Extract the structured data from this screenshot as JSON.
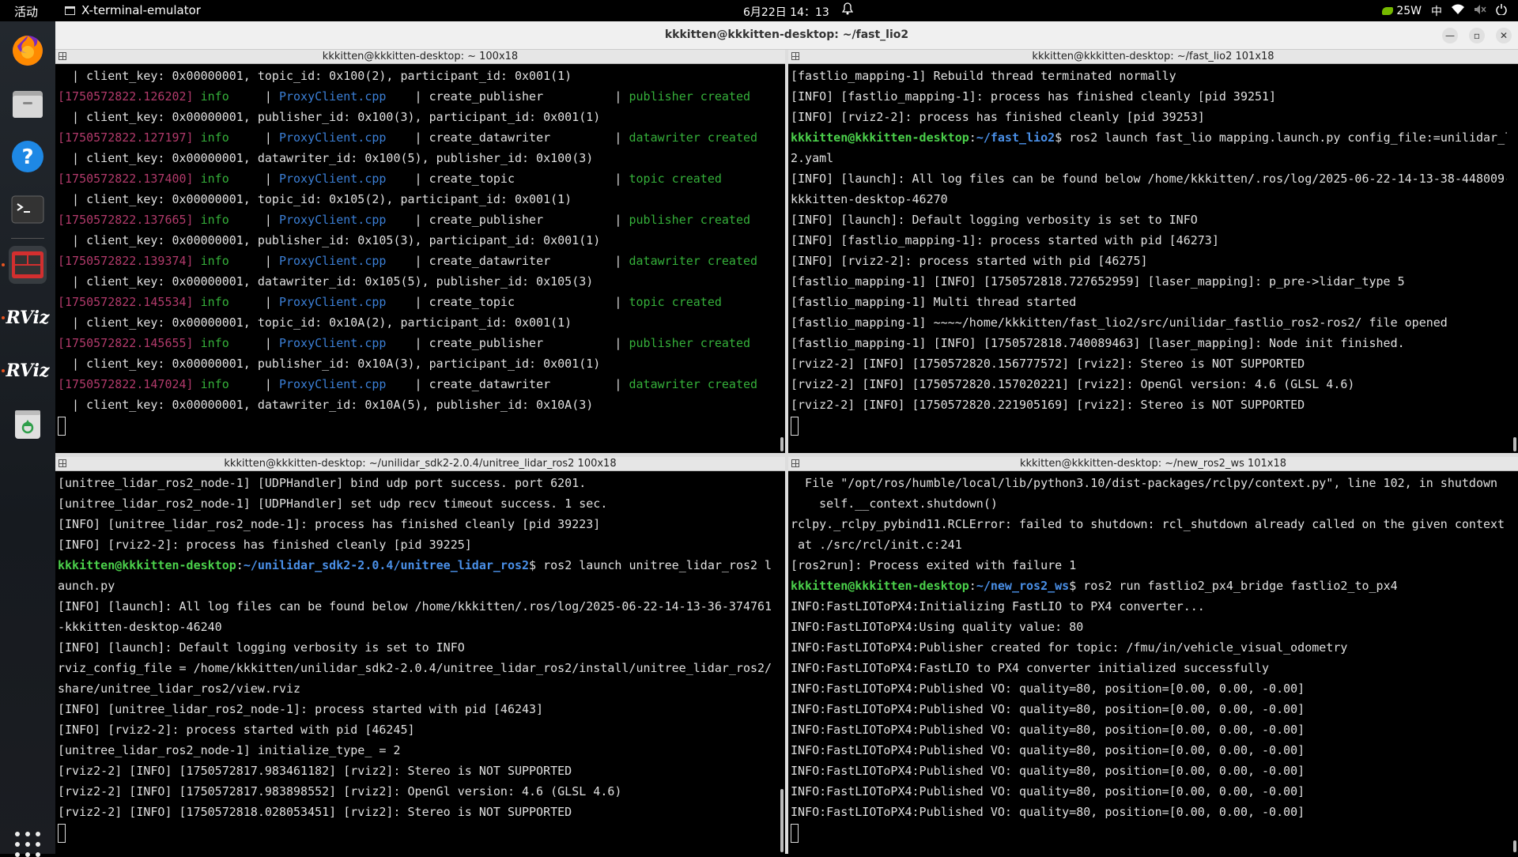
{
  "topbar": {
    "activities": "活动",
    "app_name": "X-terminal-emulator",
    "datetime": "6月22日  14：13",
    "power": "25W",
    "input_method": "中"
  },
  "dock": {
    "icons": [
      "firefox-icon",
      "files-icon",
      "help-icon",
      "terminal-icon",
      "terminator-icon",
      "rviz-icon",
      "rviz-icon",
      "trash-icon"
    ],
    "rviz_label": "RViz"
  },
  "window": {
    "title": "kkkitten@kkkitten-desktop: ~/fast_lio2"
  },
  "panes": {
    "top_left": {
      "title": "kkkitten@kkkitten-desktop: ~ 100x18",
      "lines": [
        [
          {
            "t": "  | client_key: 0x00000001, topic_id: 0x100(2), participant_id: 0x001(1)"
          }
        ],
        [
          {
            "t": "[1750572822.126202]",
            "c": "ts"
          },
          {
            "t": " "
          },
          {
            "t": "info",
            "c": "info"
          },
          {
            "t": "     | "
          },
          {
            "t": "ProxyClient.cpp",
            "c": "file"
          },
          {
            "t": "    | "
          },
          {
            "t": "create_publisher",
            "c": ""
          },
          {
            "t": "          | "
          },
          {
            "t": "publisher created",
            "c": "msg"
          }
        ],
        [
          {
            "t": "  | client_key: 0x00000001, publisher_id: 0x100(3), participant_id: 0x001(1)"
          }
        ],
        [
          {
            "t": "[1750572822.127197]",
            "c": "ts"
          },
          {
            "t": " "
          },
          {
            "t": "info",
            "c": "info"
          },
          {
            "t": "     | "
          },
          {
            "t": "ProxyClient.cpp",
            "c": "file"
          },
          {
            "t": "    | "
          },
          {
            "t": "create_datawriter",
            "c": ""
          },
          {
            "t": "         | "
          },
          {
            "t": "datawriter created",
            "c": "msg"
          }
        ],
        [
          {
            "t": "  | client_key: 0x00000001, datawriter_id: 0x100(5), publisher_id: 0x100(3)"
          }
        ],
        [
          {
            "t": "[1750572822.137400]",
            "c": "ts"
          },
          {
            "t": " "
          },
          {
            "t": "info",
            "c": "info"
          },
          {
            "t": "     | "
          },
          {
            "t": "ProxyClient.cpp",
            "c": "file"
          },
          {
            "t": "    | "
          },
          {
            "t": "create_topic",
            "c": ""
          },
          {
            "t": "              | "
          },
          {
            "t": "topic created",
            "c": "msg"
          }
        ],
        [
          {
            "t": "  | client_key: 0x00000001, topic_id: 0x105(2), participant_id: 0x001(1)"
          }
        ],
        [
          {
            "t": "[1750572822.137665]",
            "c": "ts"
          },
          {
            "t": " "
          },
          {
            "t": "info",
            "c": "info"
          },
          {
            "t": "     | "
          },
          {
            "t": "ProxyClient.cpp",
            "c": "file"
          },
          {
            "t": "    | "
          },
          {
            "t": "create_publisher",
            "c": ""
          },
          {
            "t": "          | "
          },
          {
            "t": "publisher created",
            "c": "msg"
          }
        ],
        [
          {
            "t": "  | client_key: 0x00000001, publisher_id: 0x105(3), participant_id: 0x001(1)"
          }
        ],
        [
          {
            "t": "[1750572822.139374]",
            "c": "ts"
          },
          {
            "t": " "
          },
          {
            "t": "info",
            "c": "info"
          },
          {
            "t": "     | "
          },
          {
            "t": "ProxyClient.cpp",
            "c": "file"
          },
          {
            "t": "    | "
          },
          {
            "t": "create_datawriter",
            "c": ""
          },
          {
            "t": "         | "
          },
          {
            "t": "datawriter created",
            "c": "msg"
          }
        ],
        [
          {
            "t": "  | client_key: 0x00000001, datawriter_id: 0x105(5), publisher_id: 0x105(3)"
          }
        ],
        [
          {
            "t": "[1750572822.145534]",
            "c": "ts"
          },
          {
            "t": " "
          },
          {
            "t": "info",
            "c": "info"
          },
          {
            "t": "     | "
          },
          {
            "t": "ProxyClient.cpp",
            "c": "file"
          },
          {
            "t": "    | "
          },
          {
            "t": "create_topic",
            "c": ""
          },
          {
            "t": "              | "
          },
          {
            "t": "topic created",
            "c": "msg"
          }
        ],
        [
          {
            "t": "  | client_key: 0x00000001, topic_id: 0x10A(2), participant_id: 0x001(1)"
          }
        ],
        [
          {
            "t": "[1750572822.145655]",
            "c": "ts"
          },
          {
            "t": " "
          },
          {
            "t": "info",
            "c": "info"
          },
          {
            "t": "     | "
          },
          {
            "t": "ProxyClient.cpp",
            "c": "file"
          },
          {
            "t": "    | "
          },
          {
            "t": "create_publisher",
            "c": ""
          },
          {
            "t": "          | "
          },
          {
            "t": "publisher created",
            "c": "msg"
          }
        ],
        [
          {
            "t": "  | client_key: 0x00000001, publisher_id: 0x10A(3), participant_id: 0x001(1)"
          }
        ],
        [
          {
            "t": "[1750572822.147024]",
            "c": "ts"
          },
          {
            "t": " "
          },
          {
            "t": "info",
            "c": "info"
          },
          {
            "t": "     | "
          },
          {
            "t": "ProxyClient.cpp",
            "c": "file"
          },
          {
            "t": "    | "
          },
          {
            "t": "create_datawriter",
            "c": ""
          },
          {
            "t": "         | "
          },
          {
            "t": "datawriter created",
            "c": "msg"
          }
        ],
        [
          {
            "t": "  | client_key: 0x00000001, datawriter_id: 0x10A(5), publisher_id: 0x10A(3)"
          }
        ]
      ]
    },
    "top_right": {
      "title": "kkkitten@kkkitten-desktop: ~/fast_lio2 101x18",
      "lines": [
        [
          {
            "t": "[fastlio_mapping-1] Rebuild thread terminated normally"
          }
        ],
        [
          {
            "t": "[INFO] [fastlio_mapping-1]: process has finished cleanly [pid 39251]"
          }
        ],
        [
          {
            "t": "[INFO] [rviz2-2]: process has finished cleanly [pid 39253]"
          }
        ],
        [
          {
            "t": "kkkitten@kkkitten-desktop",
            "c": "user"
          },
          {
            "t": ":"
          },
          {
            "t": "~/fast_lio2",
            "c": "path"
          },
          {
            "t": "$ ros2 launch fast_lio mapping.launch.py config_file:=unilidar_l"
          }
        ],
        [
          {
            "t": "2.yaml"
          }
        ],
        [
          {
            "t": "[INFO] [launch]: All log files can be found below /home/kkkitten/.ros/log/2025-06-22-14-13-38-448009-"
          }
        ],
        [
          {
            "t": "kkkitten-desktop-46270"
          }
        ],
        [
          {
            "t": "[INFO] [launch]: Default logging verbosity is set to INFO"
          }
        ],
        [
          {
            "t": "[INFO] [fastlio_mapping-1]: process started with pid [46273]"
          }
        ],
        [
          {
            "t": "[INFO] [rviz2-2]: process started with pid [46275]"
          }
        ],
        [
          {
            "t": "[fastlio_mapping-1] [INFO] [1750572818.727652959] [laser_mapping]: p_pre->lidar_type 5"
          }
        ],
        [
          {
            "t": "[fastlio_mapping-1] Multi thread started"
          }
        ],
        [
          {
            "t": "[fastlio_mapping-1] ~~~~/home/kkkitten/fast_lio2/src/unilidar_fastlio_ros2-ros2/ file opened"
          }
        ],
        [
          {
            "t": "[fastlio_mapping-1] [INFO] [1750572818.740089463] [laser_mapping]: Node init finished."
          }
        ],
        [
          {
            "t": "[rviz2-2] [INFO] [1750572820.156777572] [rviz2]: Stereo is NOT SUPPORTED"
          }
        ],
        [
          {
            "t": "[rviz2-2] [INFO] [1750572820.157020221] [rviz2]: OpenGl version: 4.6 (GLSL 4.6)"
          }
        ],
        [
          {
            "t": "[rviz2-2] [INFO] [1750572820.221905169] [rviz2]: Stereo is NOT SUPPORTED"
          }
        ]
      ]
    },
    "bottom_left": {
      "title": "kkkitten@kkkitten-desktop: ~/unilidar_sdk2-2.0.4/unitree_lidar_ros2 100x18",
      "lines": [
        [
          {
            "t": "[unitree_lidar_ros2_node-1] [UDPHandler] bind udp port success. port 6201."
          }
        ],
        [
          {
            "t": "[unitree_lidar_ros2_node-1] [UDPHandler] set udp recv timeout success. 1 sec."
          }
        ],
        [
          {
            "t": "[INFO] [unitree_lidar_ros2_node-1]: process has finished cleanly [pid 39223]"
          }
        ],
        [
          {
            "t": "[INFO] [rviz2-2]: process has finished cleanly [pid 39225]"
          }
        ],
        [
          {
            "t": "kkkitten@kkkitten-desktop",
            "c": "user"
          },
          {
            "t": ":"
          },
          {
            "t": "~/unilidar_sdk2-2.0.4/unitree_lidar_ros2",
            "c": "path"
          },
          {
            "t": "$ ros2 launch unitree_lidar_ros2 l"
          }
        ],
        [
          {
            "t": "aunch.py"
          }
        ],
        [
          {
            "t": "[INFO] [launch]: All log files can be found below /home/kkkitten/.ros/log/2025-06-22-14-13-36-374761"
          }
        ],
        [
          {
            "t": "-kkkitten-desktop-46240"
          }
        ],
        [
          {
            "t": "[INFO] [launch]: Default logging verbosity is set to INFO"
          }
        ],
        [
          {
            "t": "rviz_config_file = /home/kkkitten/unilidar_sdk2-2.0.4/unitree_lidar_ros2/install/unitree_lidar_ros2/"
          }
        ],
        [
          {
            "t": "share/unitree_lidar_ros2/view.rviz"
          }
        ],
        [
          {
            "t": "[INFO] [unitree_lidar_ros2_node-1]: process started with pid [46243]"
          }
        ],
        [
          {
            "t": "[INFO] [rviz2-2]: process started with pid [46245]"
          }
        ],
        [
          {
            "t": "[unitree_lidar_ros2_node-1] initialize_type_ = 2"
          }
        ],
        [
          {
            "t": "[rviz2-2] [INFO] [1750572817.983461182] [rviz2]: Stereo is NOT SUPPORTED"
          }
        ],
        [
          {
            "t": "[rviz2-2] [INFO] [1750572817.983898552] [rviz2]: OpenGl version: 4.6 (GLSL 4.6)"
          }
        ],
        [
          {
            "t": "[rviz2-2] [INFO] [1750572818.028053451] [rviz2]: Stereo is NOT SUPPORTED"
          }
        ]
      ]
    },
    "bottom_right": {
      "title": "kkkitten@kkkitten-desktop: ~/new_ros2_ws 101x18",
      "lines": [
        [
          {
            "t": "  File \"/opt/ros/humble/local/lib/python3.10/dist-packages/rclpy/context.py\", line 102, in shutdown"
          }
        ],
        [
          {
            "t": "    self.__context.shutdown()"
          }
        ],
        [
          {
            "t": "rclpy._rclpy_pybind11.RCLError: failed to shutdown: rcl_shutdown already called on the given context,"
          }
        ],
        [
          {
            "t": " at ./src/rcl/init.c:241"
          }
        ],
        [
          {
            "t": "[ros2run]: Process exited with failure 1"
          }
        ],
        [
          {
            "t": "kkkitten@kkkitten-desktop",
            "c": "user"
          },
          {
            "t": ":"
          },
          {
            "t": "~/new_ros2_ws",
            "c": "path"
          },
          {
            "t": "$ ros2 run fastlio2_px4_bridge fastlio2_to_px4"
          }
        ],
        [
          {
            "t": "INFO:FastLIOToPX4:Initializing FastLIO to PX4 converter..."
          }
        ],
        [
          {
            "t": "INFO:FastLIOToPX4:Using quality value: 80"
          }
        ],
        [
          {
            "t": "INFO:FastLIOToPX4:Publisher created for topic: /fmu/in/vehicle_visual_odometry"
          }
        ],
        [
          {
            "t": "INFO:FastLIOToPX4:FastLIO to PX4 converter initialized successfully"
          }
        ],
        [
          {
            "t": "INFO:FastLIOToPX4:Published VO: quality=80, position=[0.00, 0.00, -0.00]"
          }
        ],
        [
          {
            "t": "INFO:FastLIOToPX4:Published VO: quality=80, position=[0.00, 0.00, -0.00]"
          }
        ],
        [
          {
            "t": "INFO:FastLIOToPX4:Published VO: quality=80, position=[0.00, 0.00, -0.00]"
          }
        ],
        [
          {
            "t": "INFO:FastLIOToPX4:Published VO: quality=80, position=[0.00, 0.00, -0.00]"
          }
        ],
        [
          {
            "t": "INFO:FastLIOToPX4:Published VO: quality=80, position=[0.00, 0.00, -0.00]"
          }
        ],
        [
          {
            "t": "INFO:FastLIOToPX4:Published VO: quality=80, position=[0.00, 0.00, -0.00]"
          }
        ],
        [
          {
            "t": "INFO:FastLIOToPX4:Published VO: quality=80, position=[0.00, 0.00, -0.00]"
          }
        ]
      ]
    }
  }
}
